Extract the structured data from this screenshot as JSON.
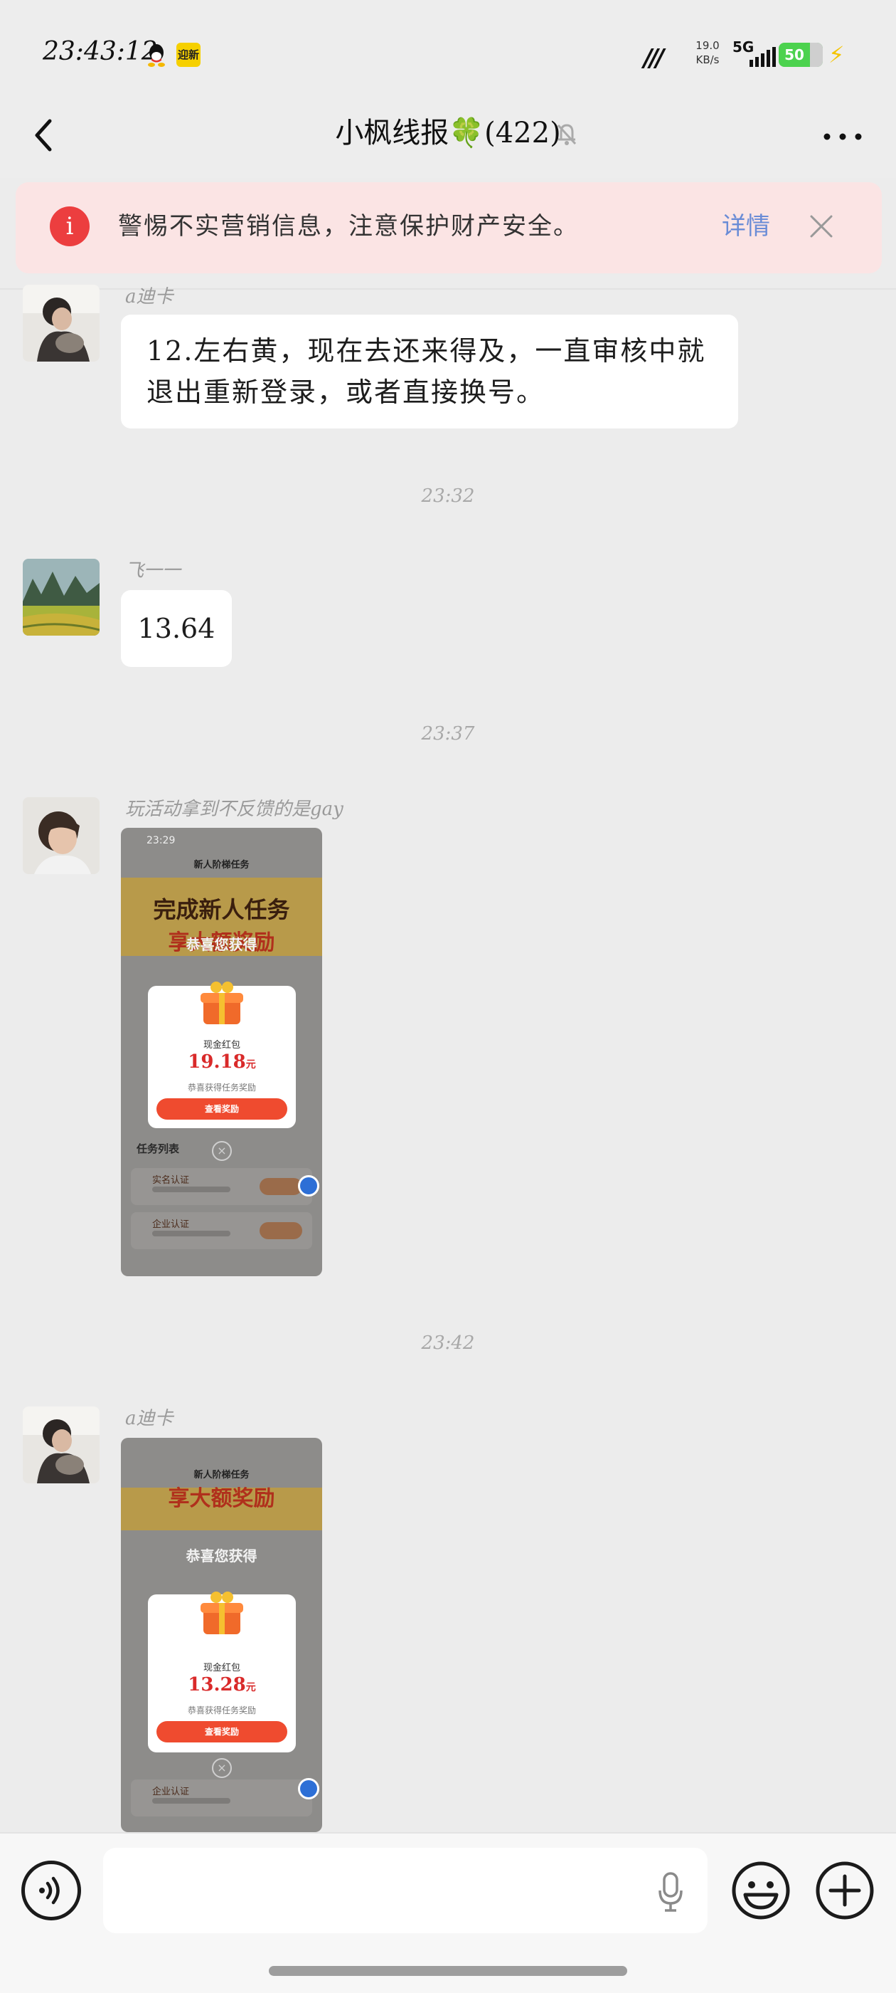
{
  "status_bar": {
    "time": "23:43:12",
    "mini_app_label": "迎新",
    "net_speed_value": "19.0",
    "net_speed_unit": "KB/s",
    "network": "5G",
    "battery": "50"
  },
  "header": {
    "title_prefix": "小枫线报",
    "title_emoji": "🍀",
    "title_count": "(422)"
  },
  "notice": {
    "icon_text": "i",
    "text": "警惕不实营销信息，注意保护财产安全。",
    "link": "详情"
  },
  "messages": [
    {
      "sender": "a迪卡",
      "text": "12.左右黄，现在去还来得及，一直审核中就退出重新登录，或者直接换号。"
    },
    {
      "time": "23:32"
    },
    {
      "sender": "飞一一",
      "text": "13.64"
    },
    {
      "time": "23:37"
    },
    {
      "sender": "玩活动拿到不反馈的是gay",
      "image": {
        "status_time": "23:29",
        "nav_title": "新人阶梯任务",
        "headline_1": "完成新人任务",
        "headline_2": "享大额奖励",
        "congrats": "恭喜您获得",
        "card_label": "现金红包",
        "amount": "19.18",
        "amount_unit": "元",
        "card_desc": "恭喜获得任务奖励",
        "card_button": "查看奖励",
        "close_icon": "×",
        "section_title": "任务列表",
        "tasks": [
          {
            "title": "实名认证"
          },
          {
            "title": "企业认证"
          }
        ]
      }
    },
    {
      "time": "23:42"
    },
    {
      "sender": "a迪卡",
      "image": {
        "nav_title": "新人阶梯任务",
        "headline_2": "享大额奖励",
        "congrats": "恭喜您获得",
        "card_label": "现金红包",
        "amount": "13.28",
        "amount_unit": "元",
        "card_desc": "恭喜获得任务奖励",
        "card_button": "查看奖励",
        "close_icon": "×",
        "tasks": [
          {
            "title": "企业认证"
          }
        ]
      }
    }
  ],
  "input": {
    "value": "",
    "placeholder": ""
  },
  "colors": {
    "background": "#ececec",
    "notice_bg": "#fbe4e4",
    "notice_icon": "#ec3e3f",
    "link": "#6a8cd6",
    "battery": "#4cd24e",
    "bubble": "#ffffff",
    "amount": "#d92a2a"
  },
  "icons": [
    "qq-icon",
    "back-icon",
    "mute-icon",
    "more-icon",
    "close-icon",
    "voice-icon",
    "mic-icon",
    "emoji-icon",
    "plus-icon"
  ]
}
